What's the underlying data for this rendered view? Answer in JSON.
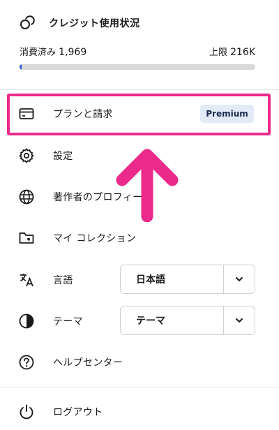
{
  "credit": {
    "title": "クレジット使用状況",
    "used_label": "消費済み",
    "used_value": "1,969",
    "limit_label": "上限",
    "limit_value": "216K",
    "progress_fraction": 0.009
  },
  "menu": {
    "plan_label": "プランと請求",
    "plan_badge": "Premium",
    "settings_label": "設定",
    "profile_label": "著作者のプロフィール",
    "collections_label": "マイ コレクション",
    "language_label": "言語",
    "language_value": "日本語",
    "theme_label": "テーマ",
    "theme_value": "テーマ",
    "help_label": "ヘルプセンター",
    "logout_label": "ログアウト"
  },
  "colors": {
    "highlight": "#ec2a8c",
    "progress": "#2a5bd7",
    "badge_bg": "#e3ebf7"
  }
}
